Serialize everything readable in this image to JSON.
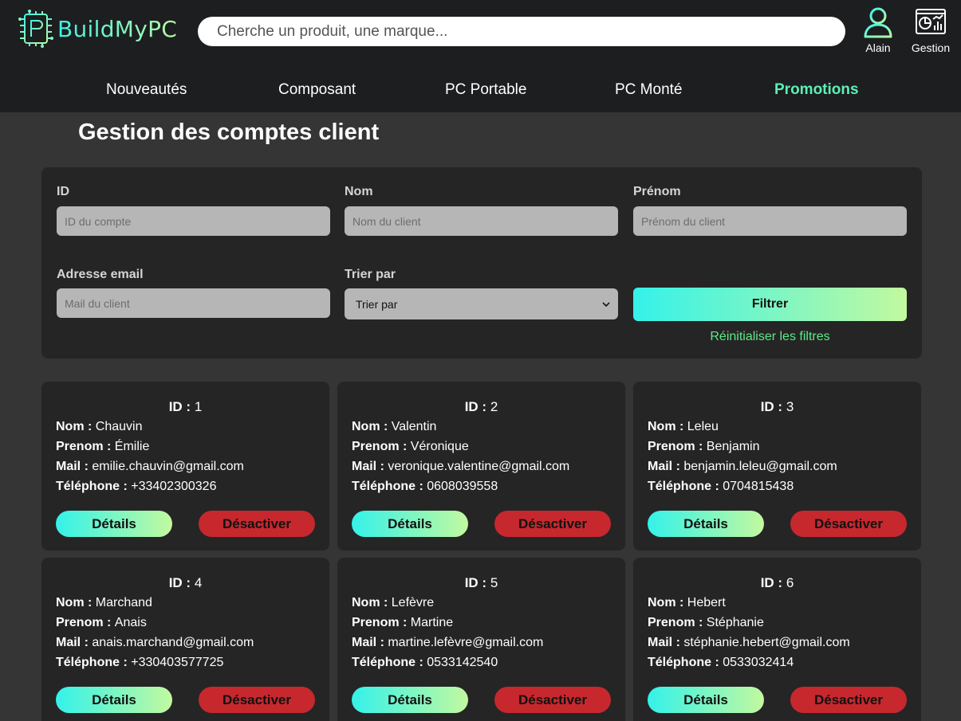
{
  "brand": {
    "name": "BuildMyPC"
  },
  "search": {
    "placeholder": "Cherche un produit, une marque..."
  },
  "header": {
    "user_label": "Alain",
    "gestion_label": "Gestion"
  },
  "nav": {
    "items": [
      {
        "label": "Nouveautés"
      },
      {
        "label": "Composant"
      },
      {
        "label": "PC Portable"
      },
      {
        "label": "PC Monté"
      },
      {
        "label": "Promotions"
      }
    ]
  },
  "page": {
    "title": "Gestion des comptes client"
  },
  "filters": {
    "id_label": "ID",
    "id_placeholder": "ID du compte",
    "nom_label": "Nom",
    "nom_placeholder": "Nom du client",
    "prenom_label": "Prénom",
    "prenom_placeholder": "Prénom du client",
    "email_label": "Adresse email",
    "email_placeholder": "Mail du client",
    "sort_label": "Trier par",
    "sort_value": "Trier par",
    "filter_button": "Filtrer",
    "reset_link": "Réinitialiser les filtres"
  },
  "card_labels": {
    "id": "ID : ",
    "nom": "Nom : ",
    "prenom": "Prenom : ",
    "mail": "Mail : ",
    "tel": "Téléphone : ",
    "details": "Détails",
    "deactivate": "Désactiver"
  },
  "clients": [
    {
      "id": "1",
      "nom": "Chauvin",
      "prenom": "Émilie",
      "mail": "emilie.chauvin@gmail.com",
      "tel": "+33402300326"
    },
    {
      "id": "2",
      "nom": "Valentin",
      "prenom": "Véronique",
      "mail": "veronique.valentine@gmail.com",
      "tel": "0608039558"
    },
    {
      "id": "3",
      "nom": "Leleu",
      "prenom": "Benjamin",
      "mail": "benjamin.leleu@gmail.com",
      "tel": "0704815438"
    },
    {
      "id": "4",
      "nom": "Marchand",
      "prenom": "Anais",
      "mail": "anais.marchand@gmail.com",
      "tel": "+330403577725"
    },
    {
      "id": "5",
      "nom": "Lefèvre",
      "prenom": "Martine",
      "mail": "martine.lefèvre@gmail.com",
      "tel": "0533142540"
    },
    {
      "id": "6",
      "nom": "Hebert",
      "prenom": "Stéphanie",
      "mail": "stéphanie.hebert@gmail.com",
      "tel": "0533032414"
    }
  ],
  "colors": {
    "accent_start": "#34f2ea",
    "accent_end": "#c2f99f",
    "danger": "#c6282e",
    "promo": "#5cf0b7",
    "reset": "#5ce98a"
  }
}
